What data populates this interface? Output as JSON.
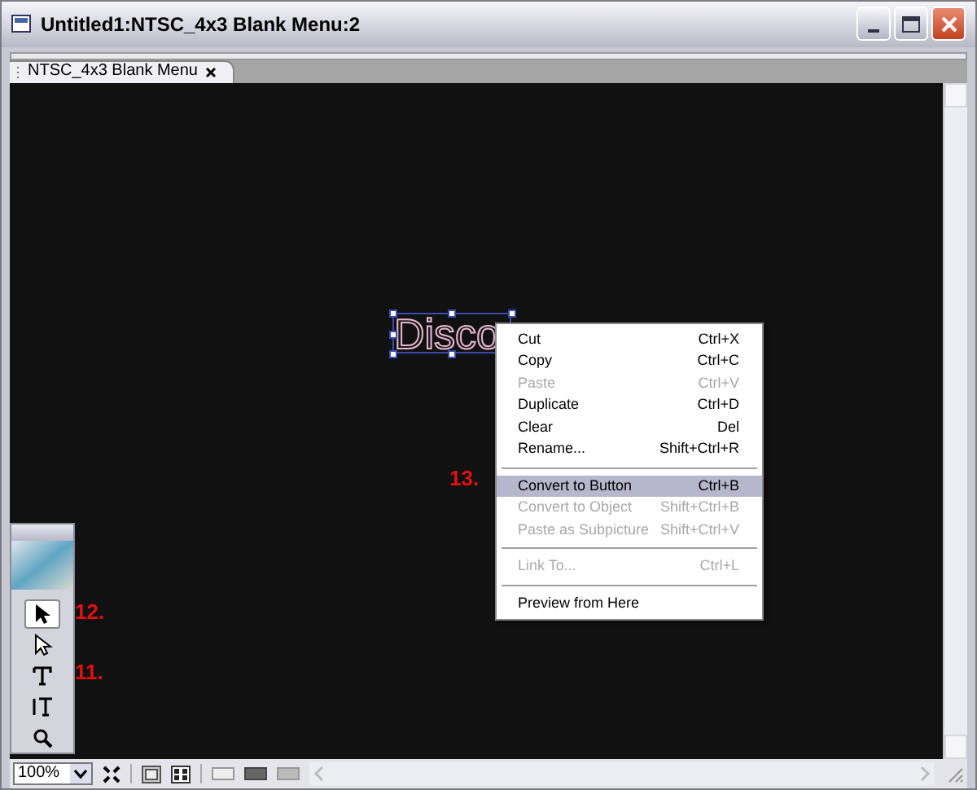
{
  "window": {
    "title": "Untitled1:NTSC_4x3 Blank Menu:2"
  },
  "tabs": [
    {
      "label": "NTSC_4x3 Blank Menu",
      "selected": true
    }
  ],
  "canvas": {
    "text_object": "Disco"
  },
  "context_menu": [
    {
      "kind": "item",
      "label": "Cut",
      "shortcut": "Ctrl+X",
      "disabled": false,
      "selected": false
    },
    {
      "kind": "item",
      "label": "Copy",
      "shortcut": "Ctrl+C",
      "disabled": false,
      "selected": false
    },
    {
      "kind": "item",
      "label": "Paste",
      "shortcut": "Ctrl+V",
      "disabled": true,
      "selected": false
    },
    {
      "kind": "item",
      "label": "Duplicate",
      "shortcut": "Ctrl+D",
      "disabled": false,
      "selected": false
    },
    {
      "kind": "item",
      "label": "Clear",
      "shortcut": "Del",
      "disabled": false,
      "selected": false
    },
    {
      "kind": "item",
      "label": "Rename...",
      "shortcut": "Shift+Ctrl+R",
      "disabled": false,
      "selected": false
    },
    {
      "kind": "separator"
    },
    {
      "kind": "item",
      "label": "Convert to Button",
      "shortcut": "Ctrl+B",
      "disabled": false,
      "selected": true
    },
    {
      "kind": "item",
      "label": "Convert to Object",
      "shortcut": "Shift+Ctrl+B",
      "disabled": true,
      "selected": false
    },
    {
      "kind": "item",
      "label": "Paste as Subpicture",
      "shortcut": "Shift+Ctrl+V",
      "disabled": true,
      "selected": false
    },
    {
      "kind": "separator"
    },
    {
      "kind": "item",
      "label": "Link To...",
      "shortcut": "Ctrl+L",
      "disabled": true,
      "selected": false
    },
    {
      "kind": "separator"
    },
    {
      "kind": "item",
      "label": "Preview from Here",
      "disabled": false,
      "selected": false
    }
  ],
  "toolbox": [
    {
      "kind": "select",
      "selected": true
    },
    {
      "kind": "direct-select",
      "selected": false
    },
    {
      "kind": "text",
      "selected": false
    },
    {
      "kind": "vertical-text",
      "selected": false
    },
    {
      "kind": "zoom",
      "selected": false
    }
  ],
  "annotations": [
    {
      "text": "13."
    },
    {
      "text": "12."
    },
    {
      "text": "11."
    }
  ],
  "status_bar": {
    "zoom": "100%"
  }
}
